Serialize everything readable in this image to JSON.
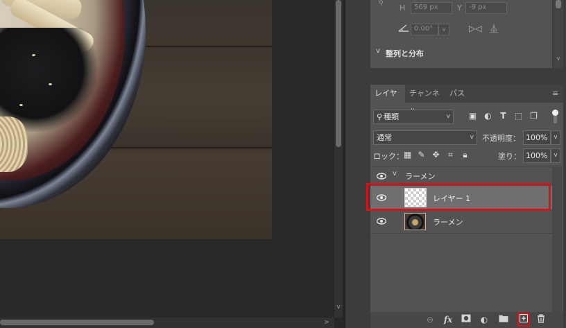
{
  "canvas": {
    "description_colors": {
      "canvas_bg": "#282828",
      "wood": "#3d352d"
    }
  },
  "properties": {
    "h_label": "H",
    "h_value": "569 px",
    "y_label": "Y",
    "y_value": "-9 px",
    "angle_value": "0.00°",
    "align_section_title": "整列と分布"
  },
  "layers_panel": {
    "tabs": [
      "レイヤー",
      "チャンネル",
      "パス"
    ],
    "filter": {
      "search_glyph": "🔍",
      "kind_label": "種類"
    },
    "blend_mode": "通常",
    "opacity_label": "不透明度：",
    "opacity_value": "100%",
    "lock_label": "ロック：",
    "fill_label": "塗り：",
    "fill_value": "100%",
    "layers": [
      {
        "name": "ラーメン",
        "type": "group",
        "expanded": true
      },
      {
        "name": "レイヤー 1",
        "type": "layer",
        "selected": true
      },
      {
        "name": "ラーメン",
        "type": "image"
      }
    ],
    "highlight_color": "#d9121a"
  },
  "icons": {
    "menu": "≡",
    "eye": "👁",
    "chevron_down": "⌄",
    "chev_small": "v"
  }
}
